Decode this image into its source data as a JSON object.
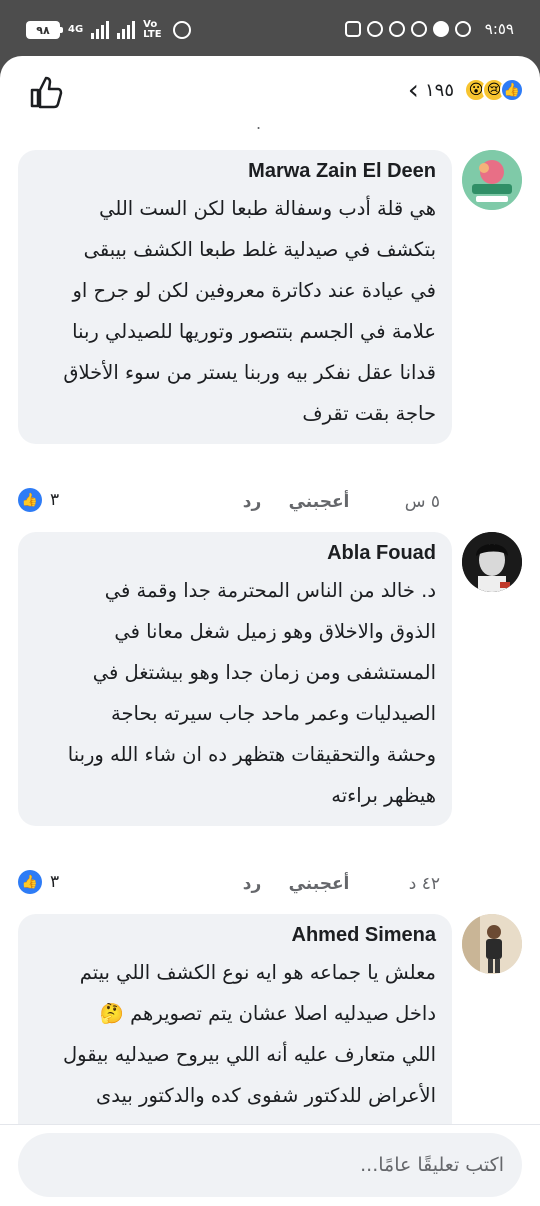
{
  "status_bar": {
    "battery": "٩٨",
    "network": "4G",
    "volte": "Vo LTE",
    "time": "٩:٥٩"
  },
  "header": {
    "reaction_count": "١٩٥",
    "icons": [
      "thumbs-up-outline-icon",
      "back-chevron-icon",
      "wow-emoji-icon",
      "sad-emoji-icon",
      "like-reaction-icon"
    ]
  },
  "comments": [
    {
      "author": "Marwa Zain El Deen",
      "text": "هي قلة أدب وسفالة طبعا لكن الست اللي\nبتكشف في صيدلية  غلط طبعا الكشف بيبقى\nفي عيادة عند دكاترة معروفين لكن لو جرح او\nعلامة في الجسم بتتصور وتوريها للصيدلي ربنا\nقدانا عقل نفكر بيه وربنا يستر من سوء الأخلاق\nحاجة بقت تقرف",
      "time": "٥ س",
      "like_label": "أعجبني",
      "reply_label": "رد",
      "likes": "٣",
      "avatar_label": "عاملات ايدي"
    },
    {
      "author": "Abla Fouad",
      "text": "د. خالد من الناس المحترمة جدا وقمة في\nالذوق والاخلاق وهو زميل شغل معانا في\nالمستشفى ومن زمان جدا وهو بيشتغل في\nالصيدليات وعمر ماحد جاب سيرته بحاجة\nوحشة والتحقيقات هتظهر ده ان شاء الله وربنا\nهيظهر براءته",
      "time": "٤٢ د",
      "like_label": "أعجبني",
      "reply_label": "رد",
      "likes": "٣"
    },
    {
      "author": "Ahmed Simena",
      "text": "معلش يا جماعه هو ايه نوع الكشف اللي بيتم\nداخل صيدليه اصلا عشان يتم تصويرهم 🤔\nاللي متعارف عليه أنه اللي بيروح صيدليه بيقول\nالأعراض للدكتور شفوى كده والدكتور بيدى"
    }
  ],
  "composer": {
    "placeholder": "اكتب تعليقًا عامًا..."
  }
}
